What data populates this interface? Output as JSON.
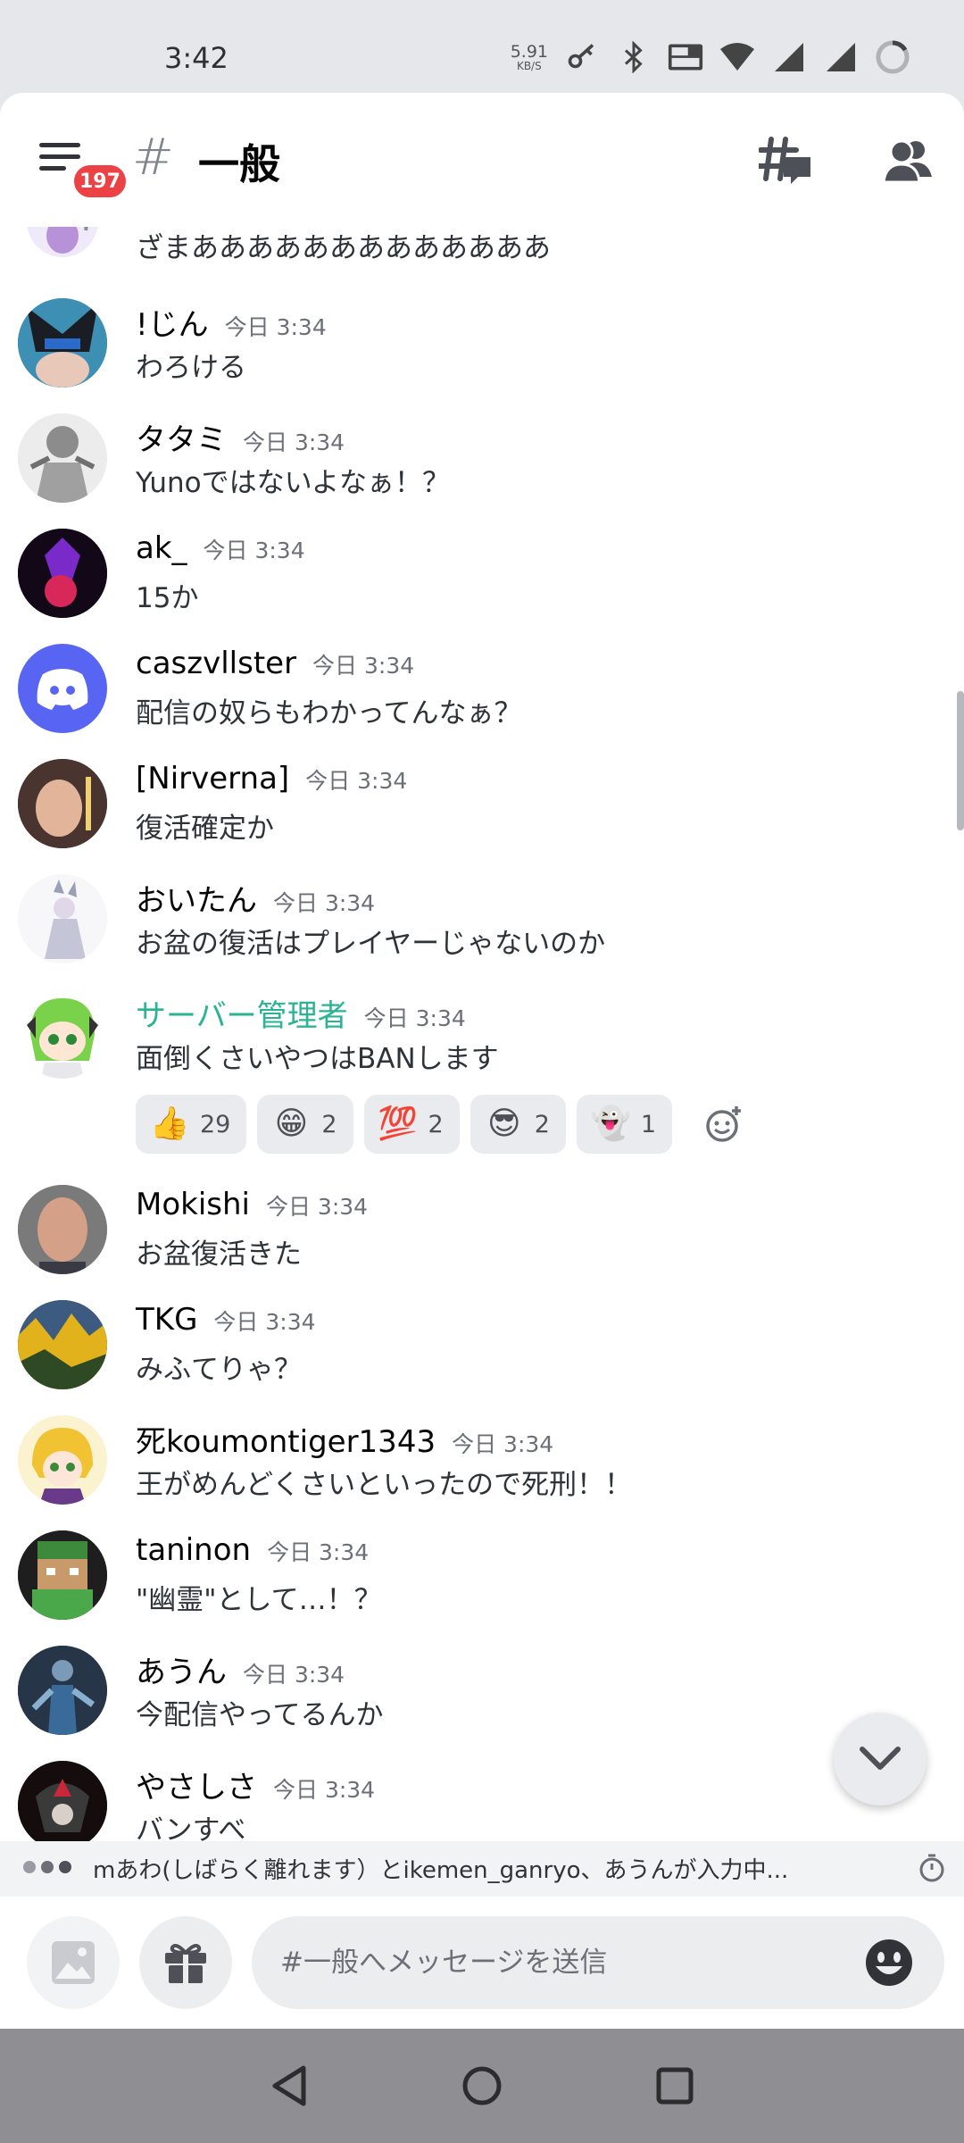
{
  "status": {
    "time": "3:42",
    "speed_value": "5.91",
    "speed_unit": "KB/S"
  },
  "header": {
    "hash": "#",
    "title": "一般",
    "badge": "197"
  },
  "messages": [
    {
      "avatar_icon": "dragon-avatar",
      "username": "",
      "time": "",
      "text": "ざまあああああああああああああ"
    },
    {
      "avatar_icon": "avatar",
      "username": "!じん",
      "time": "今日 3:34",
      "text": "わろける"
    },
    {
      "avatar_icon": "avatar",
      "username": "タタミ",
      "time": "今日 3:34",
      "text": "Yunoではないよなぁ！？"
    },
    {
      "avatar_icon": "avatar",
      "username": "ak_",
      "time": "今日 3:34",
      "text": "15か"
    },
    {
      "avatar_icon": "discord-logo",
      "username": "caszvllster",
      "time": "今日 3:34",
      "text": "配信の奴らもわかってんなぁ？"
    },
    {
      "avatar_icon": "avatar",
      "username": "[Nirverna]",
      "time": "今日 3:34",
      "text": "復活確定か"
    },
    {
      "avatar_icon": "avatar",
      "username": "おいたん",
      "time": "今日 3:34",
      "text": "お盆の復活はプレイヤーじゃないのか"
    },
    {
      "avatar_icon": "avatar",
      "username": "サーバー管理者",
      "time": "今日 3:34",
      "text": "面倒くさいやつはBANします",
      "name_color": "#2bb395"
    },
    {
      "avatar_icon": "avatar",
      "username": "Mokishi",
      "time": "今日 3:34",
      "text": "お盆復活きた"
    },
    {
      "avatar_icon": "avatar",
      "username": "TKG",
      "time": "今日 3:34",
      "text": "みふてりゃ？"
    },
    {
      "avatar_icon": "avatar",
      "username": "死koumontiger1343",
      "time": "今日 3:34",
      "text": "王がめんどくさいといったので死刑！！"
    },
    {
      "avatar_icon": "avatar",
      "username": "taninon",
      "time": "今日 3:34",
      "text": "\"幽霊\"として…！？"
    },
    {
      "avatar_icon": "avatar",
      "username": "あうん",
      "time": "今日 3:34",
      "text": "今配信やってるんか"
    },
    {
      "avatar_icon": "avatar",
      "username": "やさしさ",
      "time": "今日 3:34",
      "text": "バンすべ"
    }
  ],
  "reactions": [
    {
      "emoji": "👍",
      "icon": "thumbs-up-icon",
      "count": "29"
    },
    {
      "emoji": "😁",
      "icon": "grin-icon",
      "count": "2"
    },
    {
      "emoji": "💯",
      "icon": "hundred-icon",
      "count": "2"
    },
    {
      "emoji": "😎",
      "icon": "sunglasses-icon",
      "count": "2"
    },
    {
      "emoji": "👻",
      "icon": "ghost-icon",
      "count": "1"
    }
  ],
  "typing": {
    "text": "mあわ(しばらく離れます）とikemen_ganryo、あうんが入力中..."
  },
  "composer": {
    "placeholder": "#一般へメッセージを送信"
  },
  "colors": {
    "accent_admin": "#2bb395",
    "badge": "#ed4245",
    "discord_blurple": "#5865f2"
  }
}
